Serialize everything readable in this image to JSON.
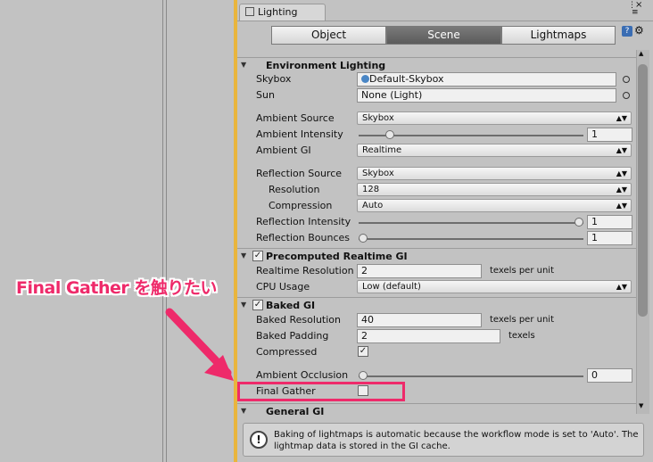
{
  "window": {
    "tab_label": "Lighting"
  },
  "toolbar": {
    "segments": [
      "Object",
      "Scene",
      "Lightmaps"
    ],
    "active": "Scene"
  },
  "sections": {
    "environment": {
      "title": "Environment Lighting",
      "skybox_label": "Skybox",
      "skybox_value": "Default-Skybox",
      "sun_label": "Sun",
      "sun_value": "None (Light)",
      "ambient_source_label": "Ambient Source",
      "ambient_source_value": "Skybox",
      "ambient_intensity_label": "Ambient Intensity",
      "ambient_intensity_value": "1",
      "ambient_gi_label": "Ambient GI",
      "ambient_gi_value": "Realtime",
      "reflection_source_label": "Reflection Source",
      "reflection_source_value": "Skybox",
      "resolution_label": "Resolution",
      "resolution_value": "128",
      "compression_label": "Compression",
      "compression_value": "Auto",
      "reflection_intensity_label": "Reflection Intensity",
      "reflection_intensity_value": "1",
      "reflection_bounces_label": "Reflection Bounces",
      "reflection_bounces_value": "1"
    },
    "precomputed": {
      "title": "Precomputed Realtime GI",
      "realtime_resolution_label": "Realtime Resolution",
      "realtime_resolution_value": "2",
      "texels_unit": "texels per unit",
      "cpu_usage_label": "CPU Usage",
      "cpu_usage_value": "Low (default)"
    },
    "baked": {
      "title": "Baked GI",
      "baked_resolution_label": "Baked Resolution",
      "baked_resolution_value": "40",
      "texels_unit": "texels per unit",
      "baked_padding_label": "Baked Padding",
      "baked_padding_value": "2",
      "texels_label": "texels",
      "compressed_label": "Compressed",
      "ambient_occlusion_label": "Ambient Occlusion",
      "ambient_occlusion_value": "0",
      "final_gather_label": "Final Gather"
    },
    "general": {
      "title": "General GI"
    }
  },
  "info_box": {
    "message": "Baking of lightmaps is automatic because the workflow mode is set to 'Auto'. The lightmap data is stored in the GI cache."
  },
  "annotation": {
    "callout_text": "Final Gather を触りたい",
    "color": "#ee2a6a"
  },
  "values": {
    "ambient_intensity": 1,
    "reflection_intensity": 1,
    "reflection_bounces": 1,
    "ambient_occlusion": 0
  }
}
